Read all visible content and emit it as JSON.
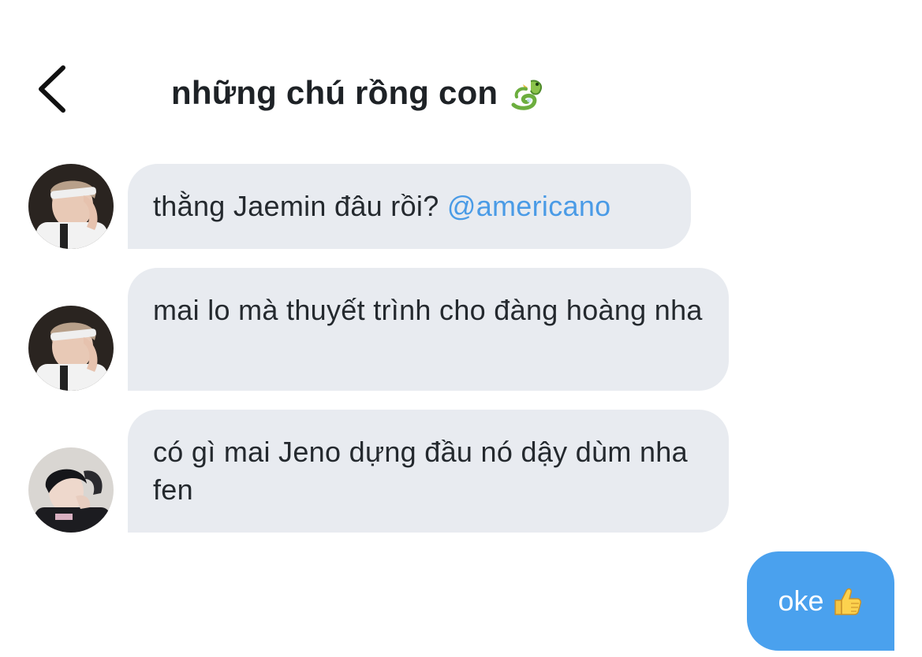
{
  "header": {
    "title": "những chú rồng con",
    "title_icon": "dragon-icon",
    "back_icon": "chevron-left-icon"
  },
  "messages": [
    {
      "sender_avatar": "avatar-user-1",
      "text": "thằng Jaemin đâu rồi? ",
      "mention": "@americano"
    },
    {
      "sender_avatar": "avatar-user-1",
      "text": "mai lo mà thuyết trình cho đàng hoàng nha"
    },
    {
      "sender_avatar": "avatar-user-2",
      "text": "có gì mai Jeno dựng đầu nó dậy dùm nha fen"
    }
  ],
  "outgoing": {
    "text": "oke",
    "icon": "thumbs-up-icon"
  },
  "colors": {
    "incoming_bubble": "#e8ebf0",
    "outgoing_bubble": "#4aa1ee",
    "mention": "#4a9be6",
    "text": "#24292e"
  }
}
